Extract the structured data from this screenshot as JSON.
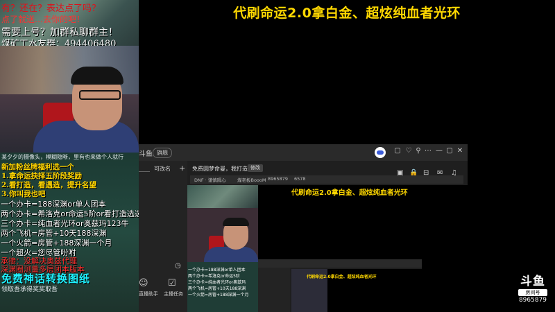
{
  "banner": "代刷命运2.0拿白金、超炫纯血者光环",
  "left_promo": {
    "line1": "有？还在？表达点了吗？",
    "line2": "点了就送…去你的吧！",
    "line3": "需要上号？加群私聊群主！",
    "line4": "煤矿工水友群：494406480"
  },
  "chat": {
    "note": "某夕夕的摄像头，模糊隐晰，里有也来做个人就行",
    "promo_lines": [
      "新加粉丝牌福利选一个",
      "1.拿命运抉择五阶段奖励",
      "2.看打造，看遇造，提升名望",
      "3.你叫我也吧"
    ],
    "price_lines": [
      "一个办卡=188深渊or单人团本",
      "两个办卡=希洛克or命运5阶or看打造选选",
      "三个办卡=纯血者光环or奥兹玛123牛",
      "两个飞机=房管+10天188深渊",
      "一个火箭=房管+188深渊一个月",
      "一个超火=您尽管吩咐"
    ],
    "red_lines": [
      "承接：没解决奥兹代理",
      "深渊圈测量多层团本版本"
    ],
    "free_text": "免费神话转换图纸",
    "bottom_note": "领取吾承得奖奖取吾"
  },
  "app": {
    "title_logo": "斗鱼",
    "pill": "旗舰",
    "nav_label": "可改名",
    "nav_add": "+",
    "top_info": "免费圆梦命曼，我打造。",
    "top_badge": "修改",
    "tags": [
      "DNF · 谨慎隔心",
      "煤老板BoooM",
      "8965879",
      "6578"
    ],
    "side_items": [
      {
        "icon": "☺",
        "label": "直播助手"
      },
      {
        "icon": "☑",
        "label": "主播任务"
      }
    ],
    "window_controls": [
      "▢",
      "♡",
      "⚲",
      "⋯",
      "—",
      "▢",
      "✕"
    ],
    "toolbar_icons": [
      "▣",
      "🔒",
      "⊟",
      "✉",
      "♫",
      "⇪"
    ],
    "stream": {
      "title": "代刷命运2.0拿白金、超炫纯血者光环",
      "mini_lines": [
        "一个办卡=188深渊or单人团本",
        "两个办卡=希洛克or命运5阶",
        "三个办卡=纯血者光环or奥兹玛",
        "两个飞机=房管+10天188深渊",
        "一个火箭=房管+188深渊一个月"
      ],
      "nested_title": "代刷命运2.0拿白金、超炫纯血者光环"
    }
  },
  "watermark": {
    "brand": "斗鱼",
    "sub": "房间号",
    "room": "8965879"
  }
}
